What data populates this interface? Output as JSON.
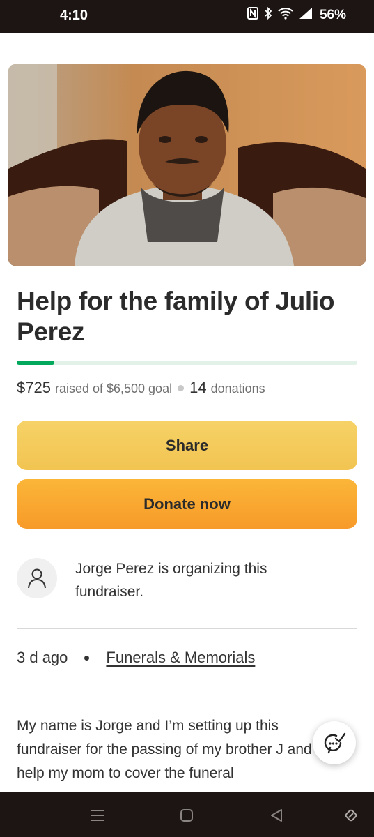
{
  "status_bar": {
    "time": "4:10",
    "battery": "56%",
    "icons": [
      "nfc-icon",
      "bluetooth-icon",
      "wifi-icon",
      "signal-icon"
    ]
  },
  "campaign": {
    "title": "Help for the family of Julio Perez",
    "image_alt": "Photo of Julio Perez",
    "progress_fraction": 0.11,
    "raised_amount": "$725",
    "raised_of_goal": "raised of $6,500 goal",
    "donation_count": "14",
    "donation_label": "donations"
  },
  "actions": {
    "share_label": "Share",
    "donate_label": "Donate now"
  },
  "organizer": {
    "text": "Jorge Perez is organizing this fundraiser.",
    "avatar_icon": "user-icon"
  },
  "meta": {
    "posted": "3 d ago",
    "category": "Funerals & Memorials"
  },
  "story": {
    "text": "My name is Jorge and I’m setting up this fundraiser for the passing of my brother J and to help my mom to cover the funeral"
  },
  "colors": {
    "progress": "#02a95c",
    "share_button": "#f4cb5c",
    "donate_button": "#f9a832",
    "system_bars": "#1c1514"
  }
}
